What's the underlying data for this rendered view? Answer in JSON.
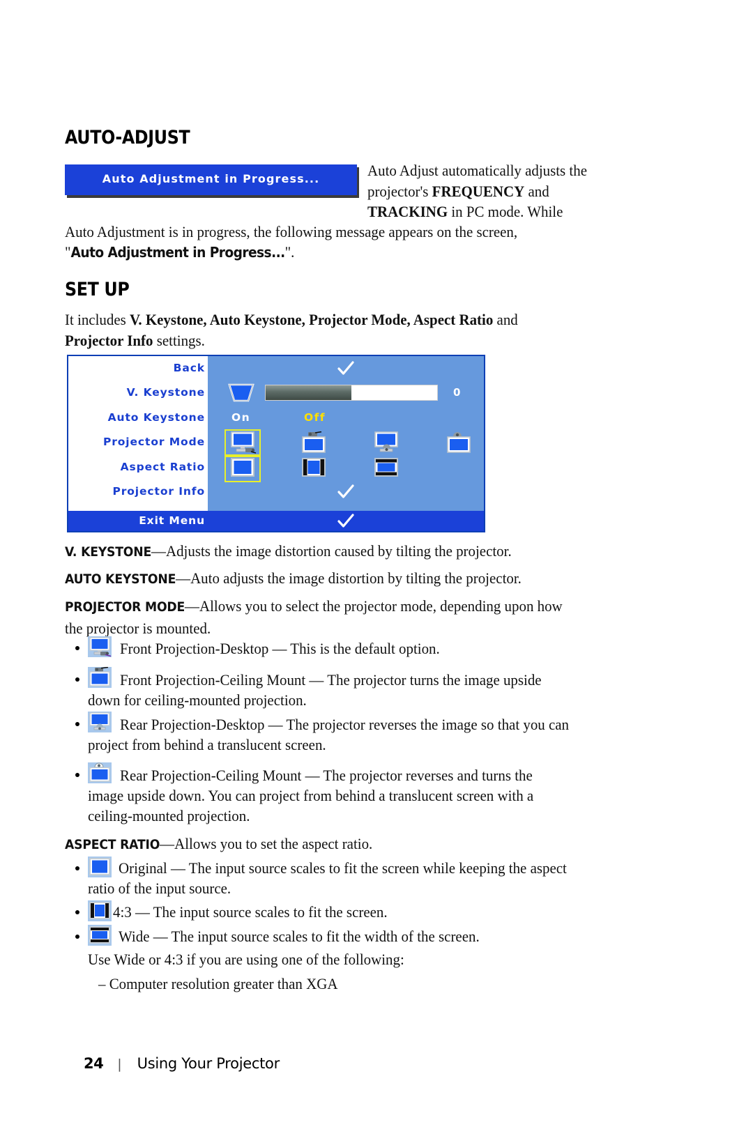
{
  "page": {
    "number": "24",
    "separator": "|",
    "footer_title": "Using Your Projector"
  },
  "sections": {
    "auto_adjust": {
      "heading": "AUTO-ADJUST",
      "osd_banner_text": "Auto Adjustment in Progress...",
      "para_line1": "Auto Adjust automatically adjusts the",
      "para_line2_a": "projector's ",
      "para_line2_b": "FREQUENCY",
      "para_line2_c": " and",
      "para_line3_a": "TRACKING",
      "para_line3_b": " in PC mode. While",
      "para_line4": "Auto Adjustment is in progress, the following message appears on the screen,",
      "para_line5_quote_open": "\"",
      "para_line5_ui": "Auto Adjustment in Progress...",
      "para_line5_quote_close": "\"."
    },
    "set_up": {
      "heading": "SET UP",
      "intro_a": "It includes ",
      "intro_b": "V. Keystone, Auto Keystone, Projector Mode, Aspect Ratio",
      "intro_c": " and",
      "intro_d": "Projector Info",
      "intro_e": " settings."
    }
  },
  "osd_menu": {
    "rows": [
      {
        "label": "Back",
        "type": "check"
      },
      {
        "label": "V. Keystone",
        "type": "slider",
        "value": "0",
        "fill_percent": 50
      },
      {
        "label": "Auto Keystone",
        "type": "onoff",
        "on_label": "On",
        "off_label": "Off",
        "selected": "Off"
      },
      {
        "label": "Projector Mode",
        "type": "icons4",
        "selected_index": 0
      },
      {
        "label": "Aspect Ratio",
        "type": "icons3",
        "selected_index": 0
      },
      {
        "label": "Projector Info",
        "type": "check"
      }
    ],
    "exit": {
      "label": "Exit Menu",
      "type": "check"
    },
    "colors": {
      "menu_background": "#6699dd",
      "label_column": "#ffffff",
      "label_text": "#1a3fd0",
      "exit_bar": "#1b41d8",
      "highlight_ring": "#e8ef2a",
      "off_text": "#ffe000"
    }
  },
  "definitions": [
    {
      "term_small": "V. K",
      "term_rest": "EYSTONE",
      "term_full": "V. KEYSTONE",
      "text": "—Adjusts the image distortion caused by tilting the projector."
    },
    {
      "term_small": "A",
      "term_rest": "UTO ",
      "term_full": "AUTO KEYSTONE",
      "text": "—Auto adjusts the image distortion by tilting the projector."
    },
    {
      "term_full": "PROJECTOR MODE",
      "text_line1": "—Allows you to select the projector mode, depending upon how",
      "text_line2": "the projector is mounted."
    }
  ],
  "projector_mode_bullets": [
    {
      "icon": "front-projection-desktop-icon",
      "line1": "Front Projection-Desktop — This is the default option."
    },
    {
      "icon": "front-projection-ceiling-icon",
      "line1": "Front Projection-Ceiling Mount — The projector turns the image upside",
      "line2": "down for ceiling-mounted projection."
    },
    {
      "icon": "rear-projection-desktop-icon",
      "line1": "Rear Projection-Desktop — The projector reverses the image so that you can",
      "line2": "project from behind a translucent screen."
    },
    {
      "icon": "rear-projection-ceiling-icon",
      "line1": "Rear Projection-Ceiling Mount — The projector reverses and turns the",
      "line2": "image upside down. You can project from behind a translucent screen with a",
      "line3": "ceiling-mounted projection."
    }
  ],
  "aspect_ratio": {
    "term_full": "ASPECT RATIO",
    "term_text": "—Allows you to set the aspect ratio.",
    "bullets": [
      {
        "icon": "aspect-original-icon",
        "line1": "Original — The input source scales to fit the screen while keeping the aspect",
        "line2": "ratio of the input source."
      },
      {
        "icon": "aspect-4-3-icon",
        "line1": "4:3 — The input source scales to fit the screen."
      },
      {
        "icon": "aspect-wide-icon",
        "line1": "Wide — The input source scales to fit the width of the screen."
      }
    ],
    "note": "Use Wide or 4:3 if you are using one of the following:",
    "sub_item": "– Computer resolution greater than XGA"
  }
}
